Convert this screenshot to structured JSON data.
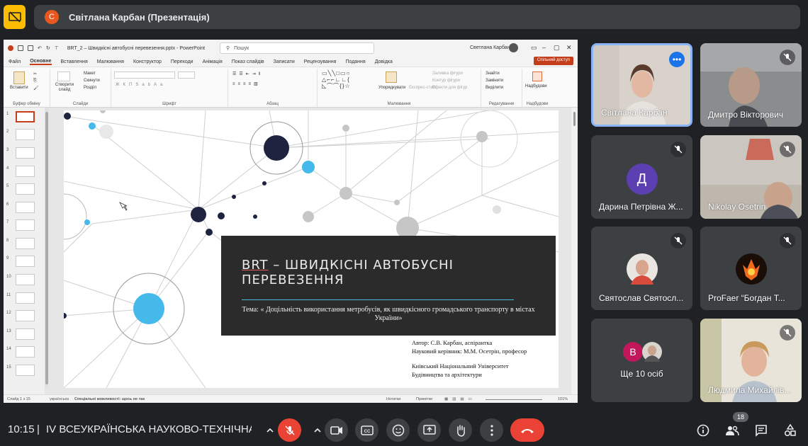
{
  "header": {
    "presenter_initial": "С",
    "presenter_title": "Світлана Карбан (Презентація)"
  },
  "powerpoint": {
    "filename": "BRT_2 – Швидкісні автобусні перевезення.pptx - PowerPoint",
    "search_placeholder": "Пошук",
    "user_name": "Светлана Карбан",
    "tabs": [
      "Файл",
      "Основне",
      "Вставлення",
      "Малювання",
      "Конструктор",
      "Переходи",
      "Анімація",
      "Показ слайдів",
      "Записати",
      "Рецензування",
      "Подання",
      "Довідка"
    ],
    "share_label": "Спільний доступ",
    "ribbon": {
      "paste": "Вставити",
      "new_slide": "Створити слайд",
      "layout": "Макет",
      "reset": "Скинути",
      "section": "Розділ",
      "clipboard": "Буфер обміну",
      "slides": "Слайди",
      "font": "Шрифт",
      "paragraph": "Абзац",
      "arrange": "Упорядкувати",
      "quick_styles": "Експрес-стилі",
      "shape_fill": "Заливка фігури",
      "shape_outline": "Контур фігури",
      "shape_effects": "Ефекти для фігур",
      "drawing": "Малювання",
      "find": "Знайти",
      "replace": "Замінити",
      "select": "Виділити",
      "editing": "Редагування",
      "addins": "Надбудови",
      "addins_group": "Надбудови"
    },
    "thumbnail_numbers": [
      "1",
      "2",
      "3",
      "4",
      "5",
      "6",
      "7",
      "8",
      "9",
      "10",
      "11",
      "12",
      "13",
      "14",
      "15"
    ],
    "slide": {
      "title_acronym": "BRT",
      "title_rest": " – ШВИДКІСНІ АВТОБУСНІ ПЕРЕВЕЗЕННЯ",
      "subtitle": "Тема: « Доцільність використання метробусів, як швидкісного громадського транспорту в містах України»",
      "author_line": "Автор: С.В. Карбан, аспірантка",
      "supervisor_line": "Науковий керівник: М.М. Осетрін, професор",
      "university_line1": "Київський Національний Університет",
      "university_line2": "Будівництва та архітектури"
    },
    "status": {
      "slide_counter": "Слайд 1 з 15",
      "language": "українська",
      "accessibility": "Спеціальні можливості: щось не так",
      "notes": "Нотатки",
      "comments": "Примітки",
      "zoom": "101%"
    }
  },
  "participants": [
    {
      "name": "Світлана Карбан",
      "active": true
    },
    {
      "name": "Дмитро Вікторович",
      "muted": true
    },
    {
      "name": "Дарина Петрівна Ж...",
      "initial": "Д",
      "avatar_color": "#5c3fb0",
      "muted": true
    },
    {
      "name": "Nikolay Osetrin",
      "muted": true
    },
    {
      "name": "Святослав Святосл...",
      "muted": true
    },
    {
      "name": "ProFaer “Богдан Т...",
      "muted": true
    },
    {
      "name": "Ще 10 осіб",
      "initial": "В",
      "avatar_color": "#c2185b"
    },
    {
      "name": "Людмила Михайлів...",
      "muted": true
    }
  ],
  "bottom": {
    "time": "10:15",
    "separator": "|",
    "meeting_title": "IV ВСЕУКРАЇНСЬКА НАУКОВО-ТЕХНІЧНА І...",
    "people_count": "18"
  },
  "colors": {
    "accent_red": "#ea4335",
    "active_border": "#8ab4f8",
    "presenter_icon": "#fbbc04",
    "ppt_accent": "#c43e1c"
  }
}
